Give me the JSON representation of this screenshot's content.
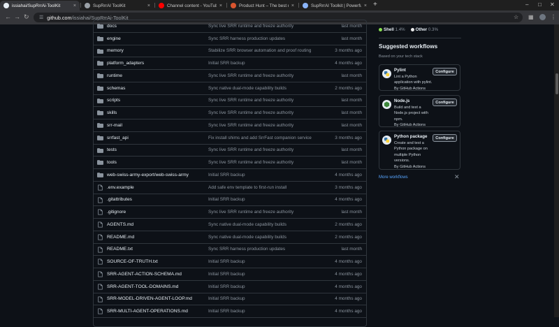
{
  "browser": {
    "tabs": [
      {
        "title": "issiahai/SupRrrAi-ToolKit",
        "active": true,
        "favicon": "github-icon",
        "color": "#e6edf3"
      },
      {
        "title": "SupRrrAI ToolKit",
        "active": false,
        "favicon": "page-icon",
        "color": "#9aa0a6"
      },
      {
        "title": "Channel content - YouTube Studio",
        "active": false,
        "favicon": "youtube-icon",
        "color": "#ff0000"
      },
      {
        "title": "Product Hunt – The best new products",
        "active": false,
        "favicon": "product-hunt-icon",
        "color": "#da552f"
      },
      {
        "title": "SupRrrAI Toolkit | Powerful AI",
        "active": false,
        "favicon": "globe-icon",
        "color": "#8ab4f8"
      }
    ],
    "new_tab": "+",
    "url_host": "github.com",
    "url_path": "/issiahai/SupRrrAi-ToolKit"
  },
  "files": [
    {
      "name": "docs",
      "type": "folder",
      "message": "Sync live SRR runtime and freeze authority",
      "time": "last month"
    },
    {
      "name": "engine",
      "type": "folder",
      "message": "Sync SRR harness production updates",
      "time": "last month"
    },
    {
      "name": "memory",
      "type": "folder",
      "message": "Stabilize SRR browser automation and proof routing",
      "time": "3 months ago"
    },
    {
      "name": "platform_adapters",
      "type": "folder",
      "message": "Initial SRR backup",
      "time": "4 months ago"
    },
    {
      "name": "runtime",
      "type": "folder",
      "message": "Sync live SRR runtime and freeze authority",
      "time": "last month"
    },
    {
      "name": "schemas",
      "type": "folder",
      "message": "Sync native dual-mode capability builds",
      "time": "2 months ago"
    },
    {
      "name": "scripts",
      "type": "folder",
      "message": "Sync live SRR runtime and freeze authority",
      "time": "last month"
    },
    {
      "name": "skills",
      "type": "folder",
      "message": "Sync live SRR runtime and freeze authority",
      "time": "last month"
    },
    {
      "name": "srr-mail",
      "type": "folder",
      "message": "Sync live SRR runtime and freeze authority",
      "time": "last month"
    },
    {
      "name": "srrfast_api",
      "type": "folder",
      "message": "Fix install shims and add SrrFast companion service",
      "time": "3 months ago"
    },
    {
      "name": "tests",
      "type": "folder",
      "message": "Sync live SRR runtime and freeze authority",
      "time": "last month"
    },
    {
      "name": "tools",
      "type": "folder",
      "message": "Sync live SRR runtime and freeze authority",
      "time": "last month"
    },
    {
      "name": "web-swiss-army-export/web-swiss-army",
      "type": "folder",
      "message": "Initial SRR backup",
      "time": "4 months ago"
    },
    {
      "name": ".env.example",
      "type": "file",
      "message": "Add safe env template to first-run install",
      "time": "3 months ago"
    },
    {
      "name": ".gitattributes",
      "type": "file",
      "message": "Initial SRR backup",
      "time": "4 months ago"
    },
    {
      "name": ".gitignore",
      "type": "file",
      "message": "Sync live SRR runtime and freeze authority",
      "time": "last month"
    },
    {
      "name": "AGENTS.md",
      "type": "file",
      "message": "Sync native dual-mode capability builds",
      "time": "2 months ago"
    },
    {
      "name": "README.md",
      "type": "file",
      "message": "Sync native dual-mode capability builds",
      "time": "2 months ago"
    },
    {
      "name": "README.txt",
      "type": "file",
      "message": "Sync SRR harness production updates",
      "time": "last month"
    },
    {
      "name": "SOURCE-OF-TRUTH.txt",
      "type": "file",
      "message": "Initial SRR backup",
      "time": "4 months ago"
    },
    {
      "name": "SRR-AGENT-ACTION-SCHEMA.md",
      "type": "file",
      "message": "Initial SRR backup",
      "time": "4 months ago"
    },
    {
      "name": "SRR-AGENT-TOOL-DOMAINS.md",
      "type": "file",
      "message": "Initial SRR backup",
      "time": "4 months ago"
    },
    {
      "name": "SRR-MODEL-DRIVEN-AGENT-LOOP.md",
      "type": "file",
      "message": "Initial SRR backup",
      "time": "4 months ago"
    },
    {
      "name": "SRR-MULTI-AGENT-OPERATIONS.md",
      "type": "file",
      "message": "Initial SRR backup",
      "time": "4 months ago"
    }
  ],
  "languages": [
    {
      "name": "Shell",
      "pct": "1.4%",
      "color": "#89e051"
    },
    {
      "name": "Other",
      "pct": "0.3%",
      "color": "#ededed"
    }
  ],
  "suggested": {
    "title": "Suggested workflows",
    "subtitle": "Based on your tech stack",
    "more": "More workflows",
    "close": "✕",
    "cards": [
      {
        "name": "Pylint",
        "lines": [
          "Lint a Python",
          "application with pylint.",
          "By GitHub Actions"
        ],
        "button": "Configure",
        "logo": "python-icon"
      },
      {
        "name": "Node.js",
        "lines": [
          "Build and test a",
          "Node.js project with",
          "npm.",
          "By GitHub Actions"
        ],
        "button": "Configure",
        "logo": "nodejs-icon"
      },
      {
        "name": "Python package",
        "lines": [
          "Create and test a",
          "Python package on",
          "multiple Python",
          "versions.",
          "By GitHub Actions"
        ],
        "button": "Configure",
        "logo": "python-icon"
      }
    ]
  }
}
